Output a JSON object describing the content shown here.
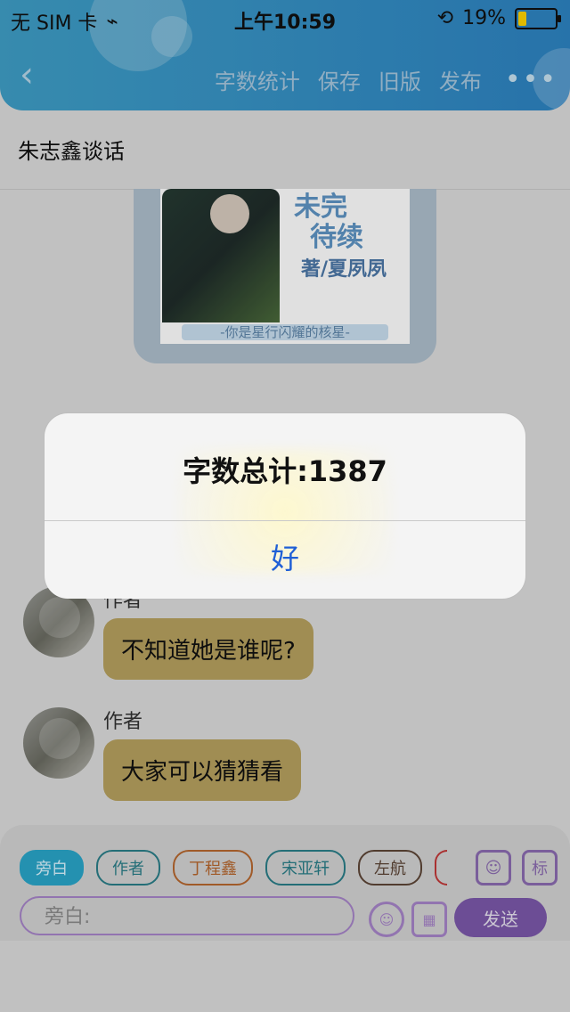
{
  "status": {
    "carrier": "无 SIM 卡",
    "time": "上午10:59",
    "battery_percent": "19%"
  },
  "nav": {
    "back_label": "‹",
    "items": [
      "字数统计",
      "保存",
      "旧版",
      "发布"
    ],
    "more_label": "•••"
  },
  "title": "朱志鑫谈话",
  "cover": {
    "line1": "未完",
    "line2": "待续",
    "line3": "著/夏夙夙",
    "bottom": "-你是星行闪耀的核星-"
  },
  "messages": [
    {
      "sender": "作者",
      "text": "不知道她是谁呢?"
    },
    {
      "sender": "作者",
      "text": "大家可以猜猜看"
    }
  ],
  "composer": {
    "chips": [
      "旁白",
      "作者",
      "丁程鑫",
      "宋亚轩",
      "左航"
    ],
    "tool_label_2": "标",
    "input_placeholder": "旁白:",
    "send_label": "发送"
  },
  "alert": {
    "title": "字数总计:1387",
    "ok_label": "好"
  }
}
